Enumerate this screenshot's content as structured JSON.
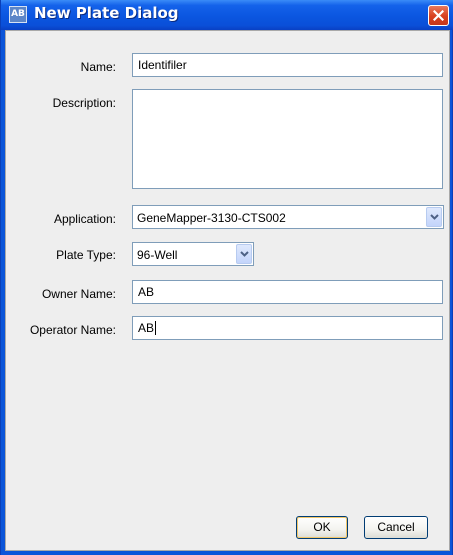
{
  "window": {
    "title": "New Plate Dialog",
    "icon": "app-icon",
    "app_icon_text": "AB",
    "close_icon": "close-icon"
  },
  "form": {
    "name_label": "Name:",
    "name_value": "Identifiler",
    "description_label": "Description:",
    "description_value": "",
    "application_label": "Application:",
    "application_value": "GeneMapper-3130-CTS002",
    "plate_type_label": "Plate Type:",
    "plate_type_value": "96-Well",
    "owner_label": "Owner Name:",
    "owner_value": "AB",
    "operator_label": "Operator Name:",
    "operator_value": "AB"
  },
  "buttons": {
    "ok": "OK",
    "cancel": "Cancel"
  },
  "colors": {
    "titlebar": "#0b56e0",
    "close_button": "#d8401f",
    "dialog_background": "#eeeeee"
  }
}
